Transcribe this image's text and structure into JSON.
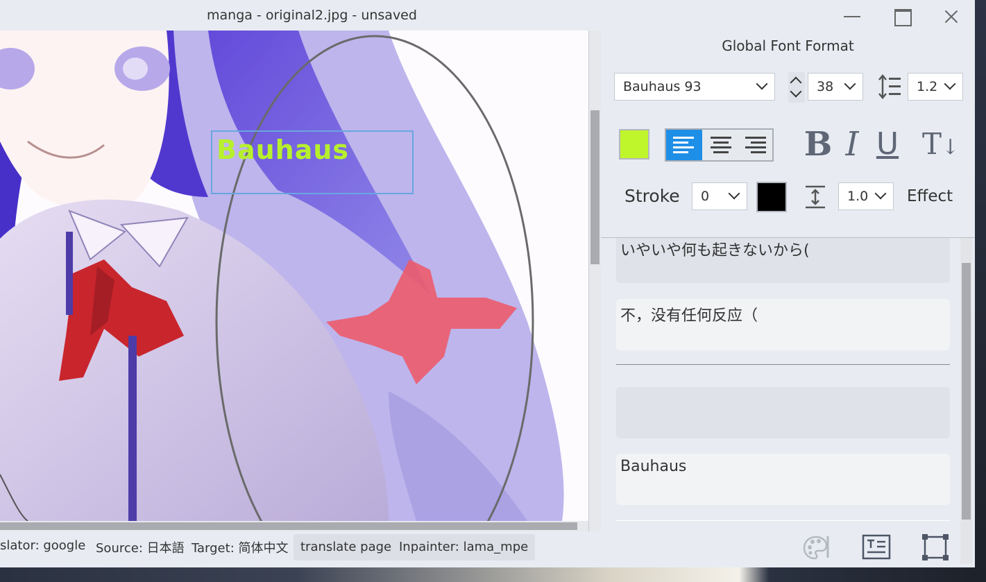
{
  "window": {
    "title": "manga - original2.jpg - unsaved"
  },
  "canvas": {
    "text_box_content": "Bauhaus"
  },
  "statusbar": {
    "translator": "slator: google",
    "source": "Source: 日本語",
    "target": "Target: 简体中文",
    "translate_page_label": "translate page",
    "inpainter": "Inpainter: lama_mpe"
  },
  "font_panel": {
    "title": "Global Font Format",
    "font_family": "Bauhaus 93",
    "font_size": "38",
    "line_spacing": "1.2",
    "font_color": "#bff52b",
    "alignment": "left",
    "bold_label": "B",
    "italic_label": "I",
    "underline_label": "U",
    "vertical_label": "T",
    "stroke_label": "Stroke",
    "stroke_width": "0",
    "stroke_color": "#000000",
    "letter_spacing": "1.0",
    "effect_label": "Effect"
  },
  "text_list": [
    {
      "source": "いやいや何も起きないから(",
      "translation": "不，没有任何反应（"
    },
    {
      "source": "",
      "translation": "Bauhaus"
    }
  ],
  "colors": {
    "accent": "#1e8fe6",
    "selection_border": "#6aa6e0"
  },
  "icons": {
    "bottom_tools": [
      "palette-icon",
      "text-format-icon",
      "select-rect-icon"
    ]
  }
}
